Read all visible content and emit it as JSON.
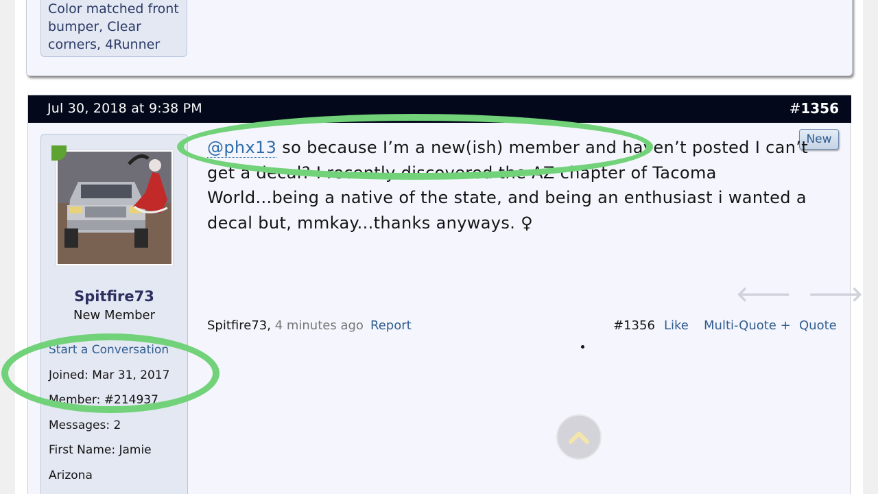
{
  "previous_post": {
    "sidebar_lines": [
      "Color matched front",
      "bumper, Clear",
      "corners, 4Runner"
    ]
  },
  "post": {
    "date": "Jul 30, 2018 at 9:38 PM",
    "number_hash": "#",
    "number": "1356",
    "new_badge": "New",
    "author": {
      "username": "Spitfire73",
      "title": "New Member",
      "start_conversation": "Start a Conversation",
      "joined": "Joined:  Mar 31, 2017",
      "member": "Member:  #214937",
      "messages": "Messages:  2",
      "first_name": "First Name:  Jamie",
      "location": "Arizona",
      "avatar_icon": "truck-avatar-image"
    },
    "message": {
      "mention": "@phx13",
      "text": " so because I’m a new(ish) member and haven’t posted I can’t get a decal? I recently discovered the AZ chapter of Tacoma World...being a native of the state, and being an enthusiast i wanted a decal but, mmkay...thanks anyways. ♀"
    },
    "footer": {
      "author": "Spitfire73",
      "separator": ", ",
      "time": "4 minutes ago",
      "report": "Report",
      "post_number": "#1356",
      "like": "Like",
      "multi_quote": "Multi-Quote +",
      "quote": "Quote"
    },
    "nav_icons": [
      "arrow-left-icon",
      "arrow-right-icon"
    ]
  },
  "annotation_color": "#72d27a"
}
